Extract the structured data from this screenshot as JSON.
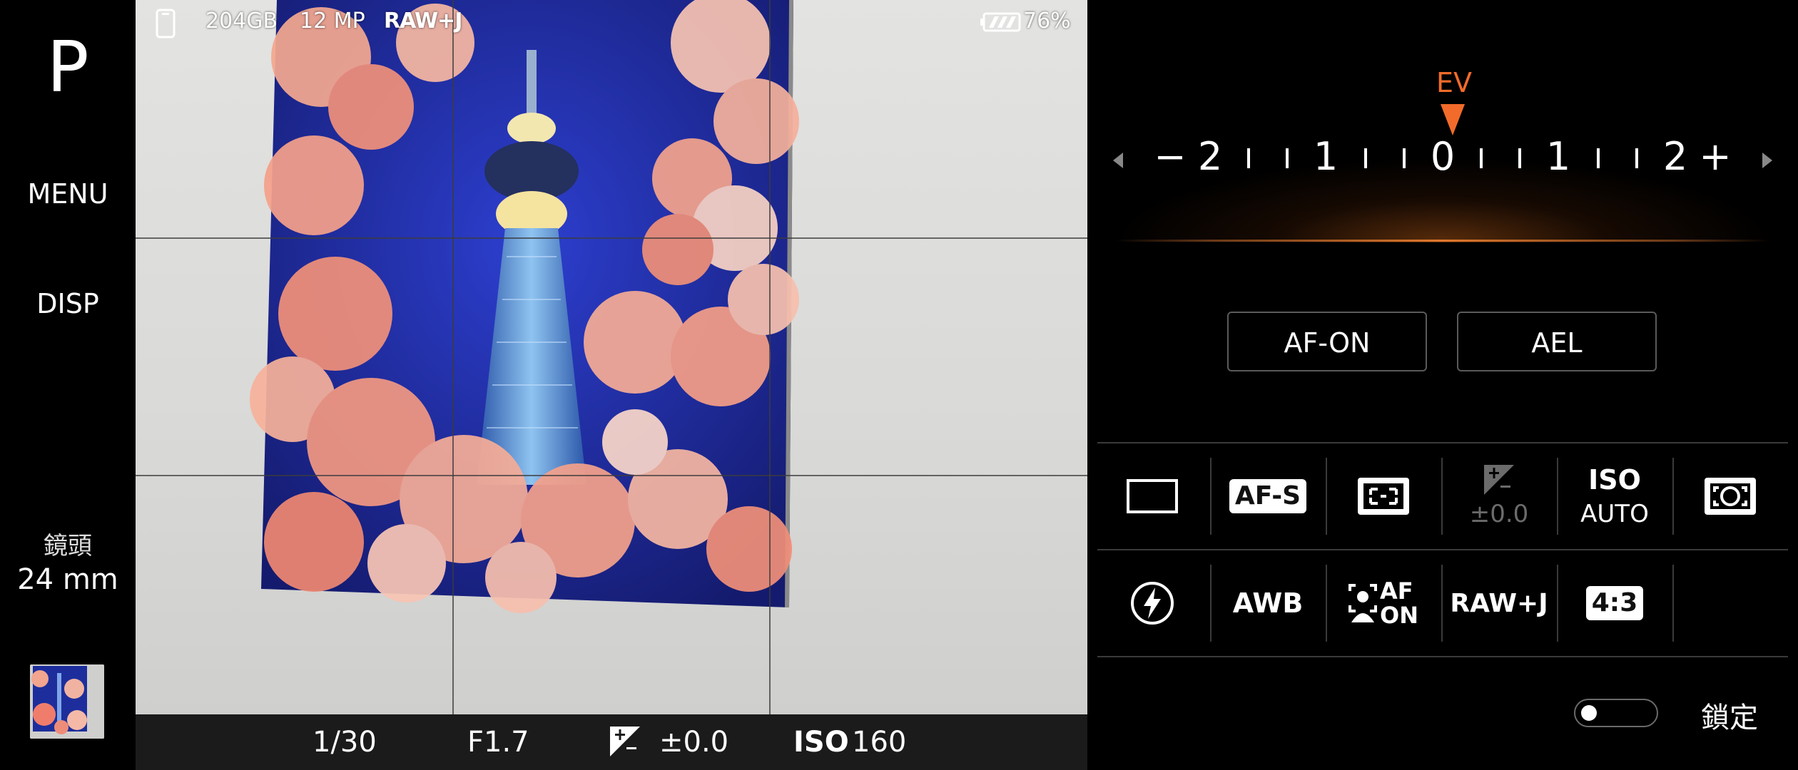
{
  "left_rail": {
    "mode": "P",
    "menu": "MENU",
    "disp": "DISP",
    "lens_label": "鏡頭",
    "lens_value": "24 mm"
  },
  "viewfinder": {
    "storage": "204GB",
    "resolution": "12 MP",
    "file_format": "RAW+J",
    "battery": "76%"
  },
  "exposure_bar": {
    "shutter": "1/30",
    "aperture": "F1.7",
    "ev_value": "±0.0",
    "iso_label": "ISO",
    "iso_value": "160"
  },
  "ev_dial": {
    "label": "EV",
    "minus": "−",
    "plus": "+",
    "scale": [
      "2",
      "1",
      "0",
      "1",
      "2"
    ],
    "accent_color": "#f26b2a"
  },
  "buttons": {
    "af_on": "AF-ON",
    "ael": "AEL"
  },
  "function_grid": {
    "drive": "single-shot-icon",
    "focus_mode": "AF-S",
    "focus_area": "focus-area-icon",
    "ev_comp": "±0.0",
    "iso_label": "ISO",
    "iso_value": "AUTO",
    "metering": "metering-icon",
    "flash": "flash-icon",
    "white_balance": "AWB",
    "face_af_line1": "AF",
    "face_af_line2": "ON",
    "file_format": "RAW+J",
    "aspect_ratio": "4:3"
  },
  "lock": {
    "label": "鎖定",
    "enabled": false
  }
}
